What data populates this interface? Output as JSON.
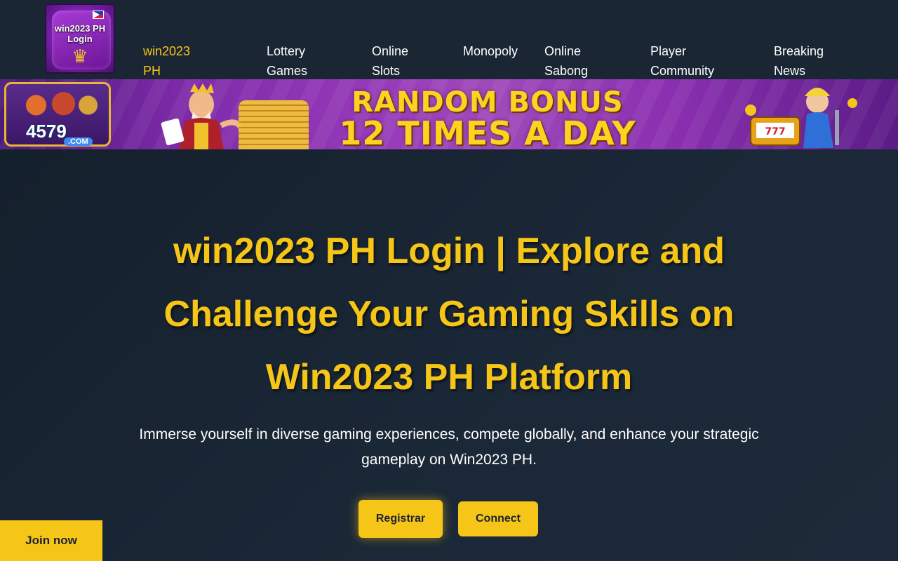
{
  "brand": {
    "logo_text": "win2023 PH\nLogin"
  },
  "nav": {
    "items": [
      {
        "label": "win2023 PH\nLogin",
        "active": true
      },
      {
        "label": "Lottery\nGames",
        "active": false
      },
      {
        "label": "Online\nSlots",
        "active": false
      },
      {
        "label": "Monopoly",
        "active": false
      },
      {
        "label": "Online\nSabong",
        "active": false
      },
      {
        "label": "Player\nCommunity",
        "active": false
      },
      {
        "label": "Breaking\nNews",
        "active": false
      }
    ]
  },
  "banner": {
    "site_number": "4579",
    "site_domain": ".COM",
    "headline_line1": "RANDOM BONUS",
    "headline_line2": "12 TIMES A DAY"
  },
  "hero": {
    "title": "win2023 PH Login | Explore and Challenge Your Gaming Skills on Win2023 PH Platform",
    "subtitle": "Immerse yourself in diverse gaming experiences, compete globally, and enhance your strategic gameplay on Win2023 PH.",
    "primary_button": "Registrar",
    "secondary_button": "Connect"
  },
  "floating": {
    "join_label": "Join now"
  },
  "colors": {
    "accent": "#f5c518",
    "header_bg": "#1b2634",
    "page_bg": "#17222f",
    "banner_purple": "#8a2fb0"
  }
}
